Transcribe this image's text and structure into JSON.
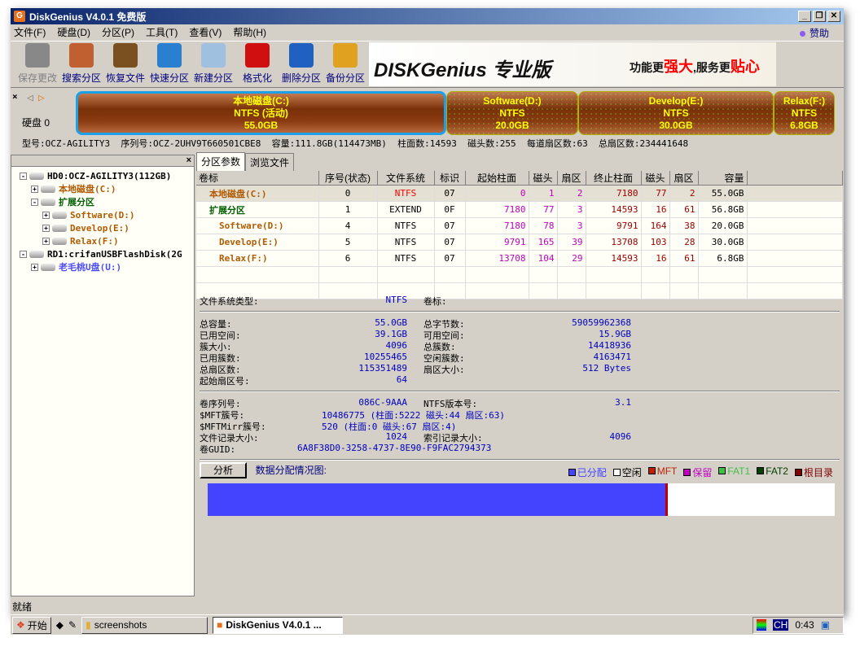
{
  "window": {
    "title": "DiskGenius V4.0.1 免费版"
  },
  "menu": [
    "文件(F)",
    "硬盘(D)",
    "分区(P)",
    "工具(T)",
    "查看(V)",
    "帮助(H)"
  ],
  "sponsor": "赞助",
  "toolbar": [
    {
      "label": "保存更改",
      "disabled": true,
      "color": "#888"
    },
    {
      "label": "搜索分区",
      "color": "#c06030"
    },
    {
      "label": "恢复文件",
      "color": "#7a5020"
    },
    {
      "label": "快速分区",
      "color": "#2a80d0"
    },
    {
      "label": "新建分区",
      "color": "#a0c0e0"
    },
    {
      "label": "格式化",
      "color": "#d01010"
    },
    {
      "label": "删除分区",
      "color": "#2060c0"
    },
    {
      "label": "备份分区",
      "color": "#e0a020"
    }
  ],
  "banner": {
    "logo": "DISKGenius 专业版",
    "slogan_a": "功能更",
    "slogan_b": "强大",
    "slogan_c": ",服务更",
    "slogan_d": "贴心"
  },
  "disk": {
    "label": "硬盘 0",
    "partitions": [
      {
        "name": "本地磁盘(C:)",
        "fs": "NTFS (活动)",
        "size": "55.0GB"
      },
      {
        "name": "Software(D:)",
        "fs": "NTFS",
        "size": "20.0GB"
      },
      {
        "name": "Develop(E:)",
        "fs": "NTFS",
        "size": "30.0GB"
      },
      {
        "name": "Relax(F:)",
        "fs": "NTFS",
        "size": "6.8GB"
      }
    ],
    "info": "型号:OCZ-AGILITY3  序列号:OCZ-2UHV9T660501CBE8  容量:111.8GB(114473MB)  柱面数:14593  磁头数:255  每道扇区数:63  总扇区数:234441648"
  },
  "tree": [
    {
      "text": "HD0:OCZ-AGILITY3(112GB)",
      "level": 0,
      "pm": "-",
      "color": "#000"
    },
    {
      "text": "本地磁盘(C:)",
      "level": 1,
      "pm": "+",
      "color": "#b05a00"
    },
    {
      "text": "扩展分区",
      "level": 1,
      "pm": "-",
      "color": "#006000"
    },
    {
      "text": "Software(D:)",
      "level": 2,
      "pm": "+",
      "color": "#b05a00"
    },
    {
      "text": "Develop(E:)",
      "level": 2,
      "pm": "+",
      "color": "#b05a00"
    },
    {
      "text": "Relax(F:)",
      "level": 2,
      "pm": "+",
      "color": "#b05a00"
    },
    {
      "text": "RD1:crifanUSBFlashDisk(2G",
      "level": 0,
      "pm": "-",
      "color": "#000"
    },
    {
      "text": "老毛桃U盘(U:)",
      "level": 1,
      "pm": "+",
      "color": "#4a4aff"
    }
  ],
  "tabs": [
    "分区参数",
    "浏览文件"
  ],
  "table": {
    "headers": [
      "卷标",
      "序号(状态)",
      "文件系统",
      "标识",
      "起始柱面",
      "磁头",
      "扇区",
      "终止柱面",
      "磁头",
      "扇区",
      "容量"
    ],
    "rows": [
      [
        "本地磁盘(C:)",
        "0",
        "NTFS",
        "07",
        "0",
        "1",
        "2",
        "7180",
        "77",
        "2",
        "55.0GB"
      ],
      [
        "扩展分区",
        "1",
        "EXTEND",
        "0F",
        "7180",
        "77",
        "3",
        "14593",
        "16",
        "61",
        "56.8GB"
      ],
      [
        "Software(D:)",
        "4",
        "NTFS",
        "07",
        "7180",
        "78",
        "3",
        "9791",
        "164",
        "38",
        "20.0GB"
      ],
      [
        "Develop(E:)",
        "5",
        "NTFS",
        "07",
        "9791",
        "165",
        "39",
        "13708",
        "103",
        "28",
        "30.0GB"
      ],
      [
        "Relax(F:)",
        "6",
        "NTFS",
        "07",
        "13708",
        "104",
        "29",
        "14593",
        "16",
        "61",
        "6.8GB"
      ]
    ]
  },
  "details": {
    "fs_type_label": "文件系统类型:",
    "fs_type": "NTFS",
    "vol_label": "卷标:",
    "grid1": [
      [
        "总容量:",
        "55.0GB",
        "总字节数:",
        "59059962368"
      ],
      [
        "已用空间:",
        "39.1GB",
        "可用空间:",
        "15.9GB"
      ],
      [
        "簇大小:",
        "4096",
        "总簇数:",
        "14418936"
      ],
      [
        "已用簇数:",
        "10255465",
        "空闲簇数:",
        "4163471"
      ],
      [
        "总扇区数:",
        "115351489",
        "扇区大小:",
        "512 Bytes"
      ],
      [
        "起始扇区号:",
        "64",
        "",
        ""
      ]
    ],
    "grid2": [
      [
        "卷序列号:",
        "086C-9AAA",
        "NTFS版本号:",
        "3.1"
      ],
      [
        "$MFT簇号:",
        "10486775 (柱面:5222 磁头:44 扇区:63)",
        "",
        ""
      ],
      [
        "$MFTMirr簇号:",
        "520 (柱面:0 磁头:67 扇区:4)",
        "",
        ""
      ],
      [
        "文件记录大小:",
        "1024",
        "索引记录大小:",
        "4096"
      ],
      [
        "卷GUID:",
        "6A8F38D0-3258-4737-8E90-F9FAC2794373",
        "",
        ""
      ]
    ]
  },
  "analysis": {
    "button": "分析",
    "label": "数据分配情况图:",
    "used_fraction": 0.73,
    "legend": [
      {
        "label": "已分配",
        "color": "#4444ff"
      },
      {
        "label": "空闲",
        "color": "#ffffff"
      },
      {
        "label": "MFT",
        "color": "#c02000"
      },
      {
        "label": "保留",
        "color": "#c000c0"
      },
      {
        "label": "FAT1",
        "color": "#40c040"
      },
      {
        "label": "FAT2",
        "color": "#004000"
      },
      {
        "label": "根目录",
        "color": "#800000"
      }
    ]
  },
  "status": "就绪",
  "taskbar": {
    "start": "开始",
    "items": [
      "screenshots",
      "DiskGenius V4.0.1 ..."
    ],
    "lang": "CH",
    "clock": "0:43"
  }
}
